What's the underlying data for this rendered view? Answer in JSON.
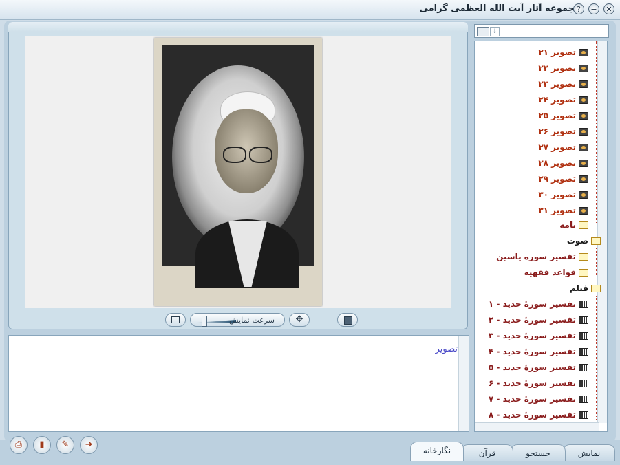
{
  "window": {
    "title": "مجموعه آثار آیت الله العظمی گرامی"
  },
  "viewer": {
    "speed_label": "سرعت نمایش"
  },
  "description": {
    "text": "تصویر"
  },
  "tree": {
    "images": [
      {
        "label": "تصویر ۲۱"
      },
      {
        "label": "تصویر ۲۲"
      },
      {
        "label": "تصویر ۲۳"
      },
      {
        "label": "تصویر ۲۴"
      },
      {
        "label": "تصویر ۲۵"
      },
      {
        "label": "تصویر ۲۶"
      },
      {
        "label": "تصویر ۲۷"
      },
      {
        "label": "تصویر ۲۸"
      },
      {
        "label": "تصویر ۲۹"
      },
      {
        "label": "تصویر ۳۰"
      },
      {
        "label": "تصویر ۳۱"
      }
    ],
    "letters_folder": "نامه",
    "audio_folder": "صوت",
    "audio_items": [
      {
        "label": "تفسیر سوره یاسین"
      },
      {
        "label": "قواعد فقهیه"
      }
    ],
    "film_folder": "فیلم",
    "film_items": [
      {
        "label": "تفسیر سورهٔ حدید - ۱"
      },
      {
        "label": "تفسیر سورهٔ حدید - ۲"
      },
      {
        "label": "تفسیر سورهٔ حدید - ۳"
      },
      {
        "label": "تفسیر سورهٔ حدید - ۴"
      },
      {
        "label": "تفسیر سورهٔ حدید - ۵"
      },
      {
        "label": "تفسیر سورهٔ حدید - ۶"
      },
      {
        "label": "تفسیر سورهٔ حدید - ۷"
      },
      {
        "label": "تفسیر سورهٔ حدید - ۸"
      }
    ]
  },
  "tabs": [
    {
      "label": "نمایش"
    },
    {
      "label": "جستجو"
    },
    {
      "label": "قرآن"
    },
    {
      "label": "نگارخانه"
    }
  ],
  "colors": {
    "tree_red": "#b03010",
    "tree_dark_red": "#8a1c1c",
    "desc_blue": "#4a4ac8"
  }
}
